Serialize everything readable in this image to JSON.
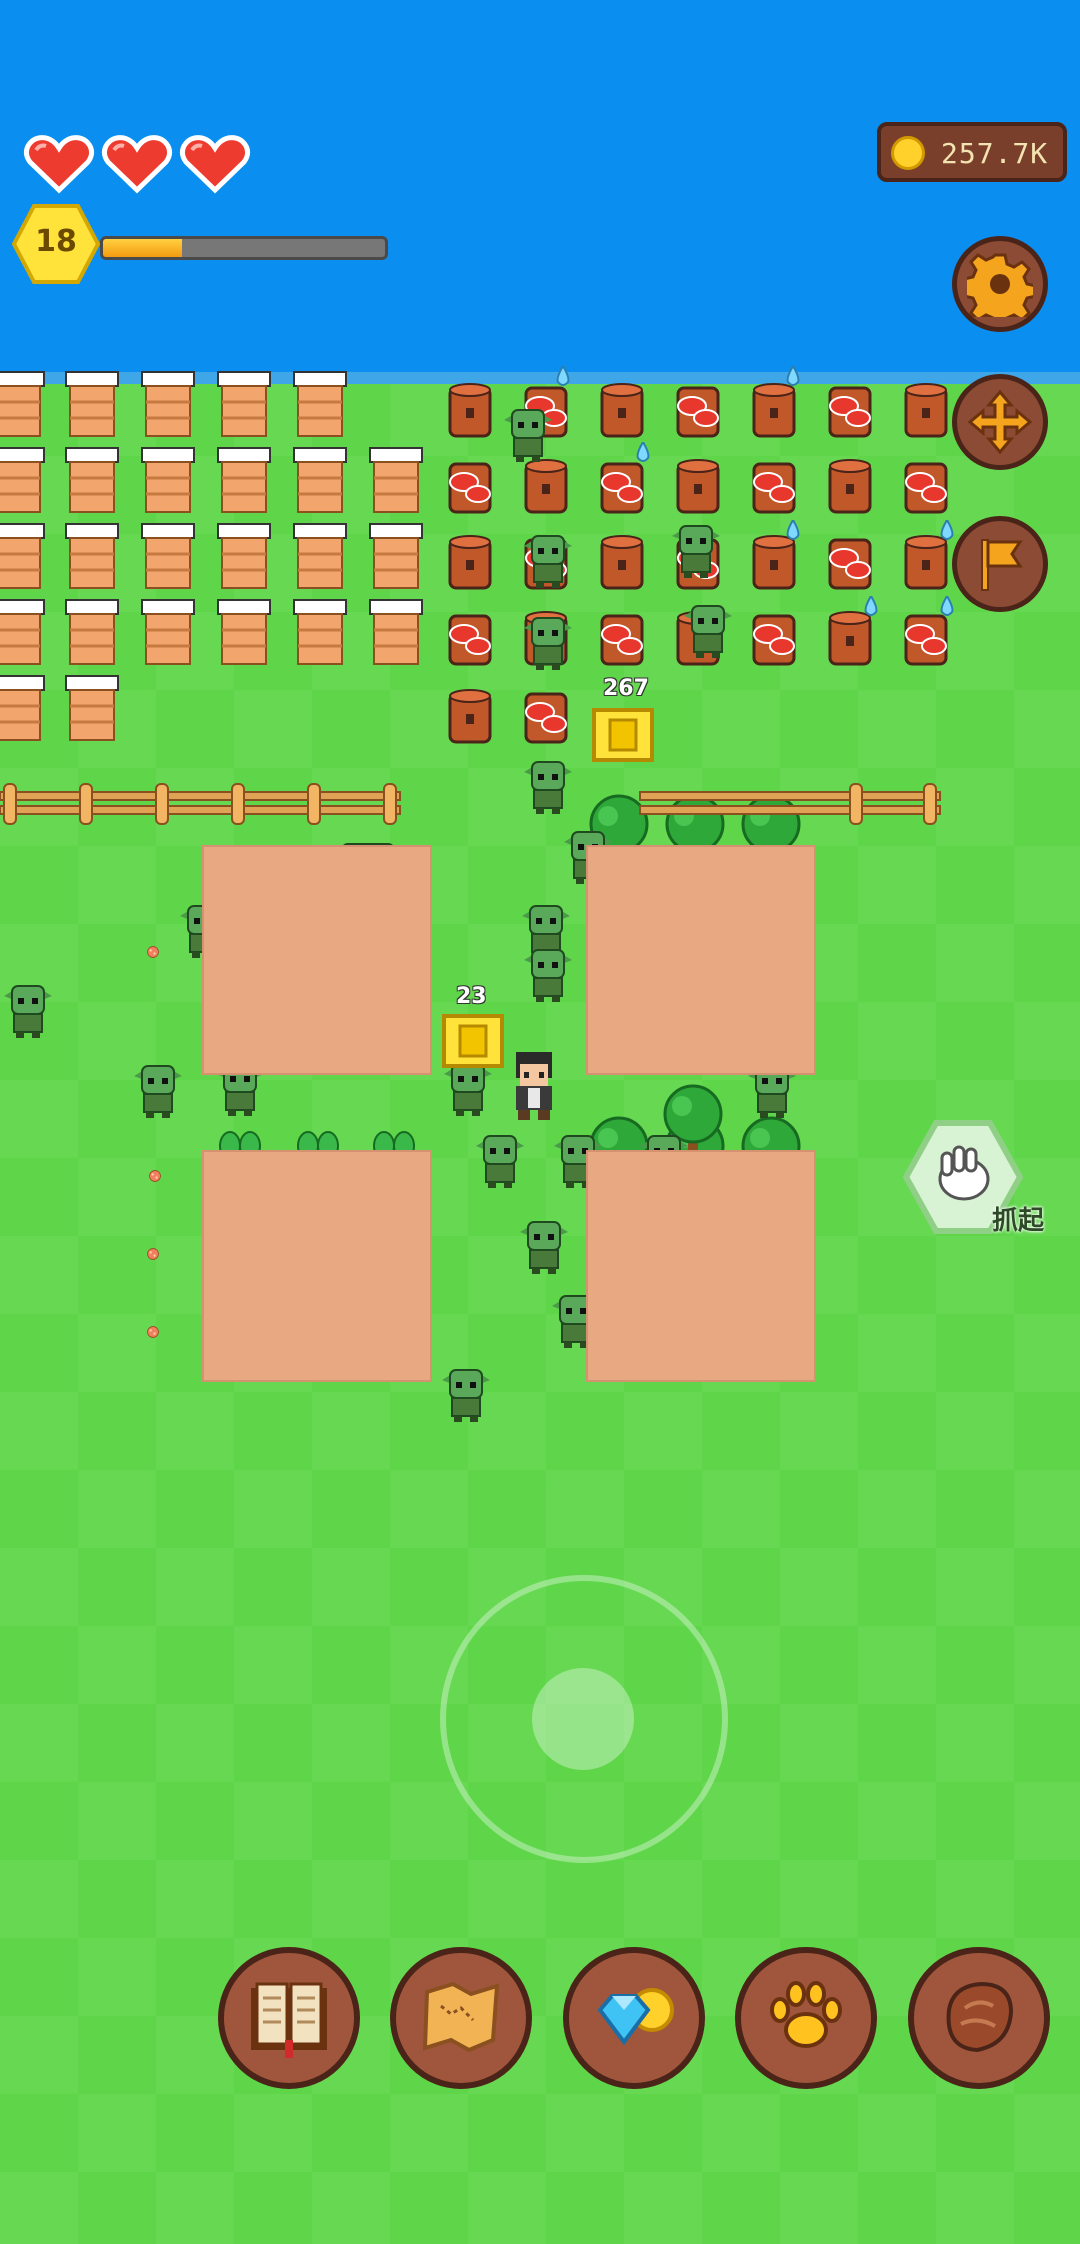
{
  "hud": {
    "hearts": [
      {
        "name": "heart-icon",
        "filled": true
      },
      {
        "name": "heart-icon",
        "filled": true
      },
      {
        "name": "heart-icon",
        "filled": true
      }
    ],
    "level": "18",
    "xp_progress": 0.28,
    "coins": "257.7K"
  },
  "side_buttons": [
    {
      "name": "settings-button",
      "icon": "gear-icon"
    },
    {
      "name": "move-button",
      "icon": "move-arrows-icon"
    },
    {
      "name": "flag-button",
      "icon": "flag-icon"
    }
  ],
  "map": {
    "storage_a_count": "267",
    "storage_b_count": "23"
  },
  "grab": {
    "label": "抓起",
    "icon": "hand-icon"
  },
  "bottom_bar": [
    {
      "name": "book-button",
      "icon": "book-icon"
    },
    {
      "name": "map-button",
      "icon": "treasure-map-icon"
    },
    {
      "name": "shop-button",
      "icon": "gem-coin-icon"
    },
    {
      "name": "pets-button",
      "icon": "paw-icon"
    },
    {
      "name": "meat-button",
      "icon": "meat-icon"
    }
  ],
  "colors": {
    "sky": "#0a8ff0",
    "grass": "#5fd64a",
    "button_wood": "#a0563c",
    "button_border": "#4a2418"
  }
}
